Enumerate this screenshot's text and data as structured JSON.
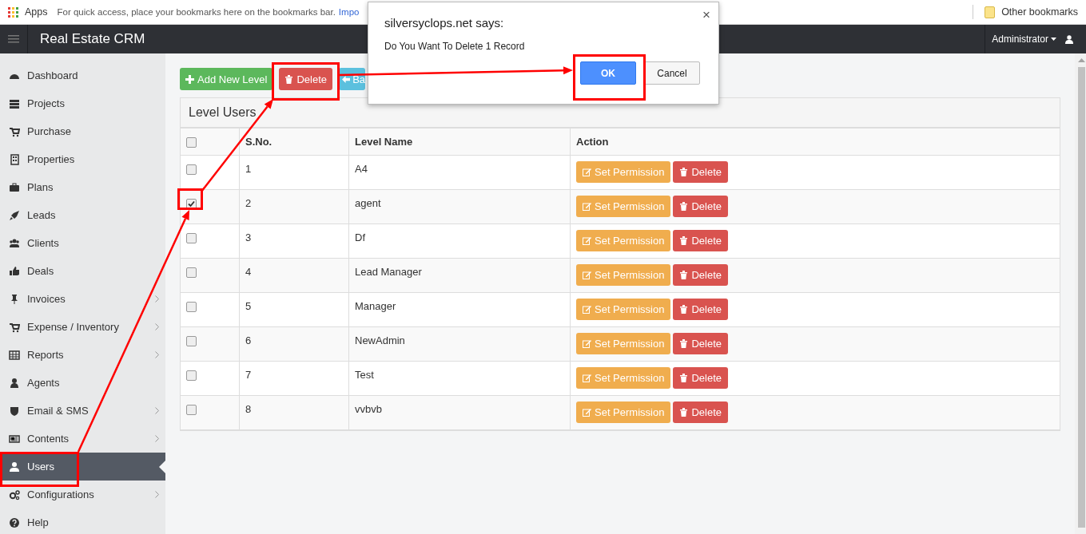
{
  "bookmarks_bar": {
    "apps_label": "Apps",
    "hint": "For quick access, place your bookmarks here on the bookmarks bar.",
    "import_link": "Impo",
    "other_bookmarks": "Other bookmarks"
  },
  "header": {
    "title": "Real Estate CRM",
    "user_menu": "Administrator"
  },
  "sidebar": {
    "items": [
      {
        "label": "Dashboard",
        "expandable": false,
        "selected": false
      },
      {
        "label": "Projects",
        "expandable": false,
        "selected": false
      },
      {
        "label": "Purchase",
        "expandable": false,
        "selected": false
      },
      {
        "label": "Properties",
        "expandable": false,
        "selected": false
      },
      {
        "label": "Plans",
        "expandable": false,
        "selected": false
      },
      {
        "label": "Leads",
        "expandable": false,
        "selected": false
      },
      {
        "label": "Clients",
        "expandable": false,
        "selected": false
      },
      {
        "label": "Deals",
        "expandable": false,
        "selected": false
      },
      {
        "label": "Invoices",
        "expandable": true,
        "selected": false
      },
      {
        "label": "Expense / Inventory",
        "expandable": true,
        "selected": false
      },
      {
        "label": "Reports",
        "expandable": true,
        "selected": false
      },
      {
        "label": "Agents",
        "expandable": false,
        "selected": false
      },
      {
        "label": "Email & SMS",
        "expandable": true,
        "selected": false
      },
      {
        "label": "Contents",
        "expandable": true,
        "selected": false
      },
      {
        "label": "Users",
        "expandable": false,
        "selected": true
      },
      {
        "label": "Configurations",
        "expandable": true,
        "selected": false
      },
      {
        "label": "Help",
        "expandable": false,
        "selected": false
      }
    ]
  },
  "toolbar": {
    "buttons": [
      {
        "kind": "add",
        "label": "Add New Level"
      },
      {
        "kind": "delete",
        "label": "Delete"
      },
      {
        "kind": "back",
        "label": "Ba"
      }
    ]
  },
  "panel": {
    "title": "Level Users",
    "table": {
      "header_checked": false,
      "columns": [
        "S.No.",
        "Level Name",
        "Action"
      ],
      "rows": [
        {
          "checked": false,
          "sno": "1",
          "name": "A4",
          "actions": [
            "Set Permission",
            "Delete"
          ]
        },
        {
          "checked": true,
          "sno": "2",
          "name": "agent",
          "actions": [
            "Set Permission",
            "Delete"
          ]
        },
        {
          "checked": false,
          "sno": "3",
          "name": "Df",
          "actions": [
            "Set Permission",
            "Delete"
          ]
        },
        {
          "checked": false,
          "sno": "4",
          "name": "Lead Manager",
          "actions": [
            "Set Permission",
            "Delete"
          ]
        },
        {
          "checked": false,
          "sno": "5",
          "name": "Manager",
          "actions": [
            "Set Permission",
            "Delete"
          ]
        },
        {
          "checked": false,
          "sno": "6",
          "name": "NewAdmin",
          "actions": [
            "Set Permission",
            "Delete"
          ]
        },
        {
          "checked": false,
          "sno": "7",
          "name": "Test",
          "actions": [
            "Set Permission",
            "Delete"
          ]
        },
        {
          "checked": false,
          "sno": "8",
          "name": "vvbvb",
          "actions": [
            "Set Permission",
            "Delete"
          ]
        }
      ]
    }
  },
  "dialog": {
    "title": "silversyclops.net says:",
    "message": "Do You Want To Delete 1 Record",
    "close": "×",
    "buttons": [
      {
        "label": "OK",
        "selected": true
      },
      {
        "label": "Cancel",
        "selected": false
      }
    ]
  }
}
